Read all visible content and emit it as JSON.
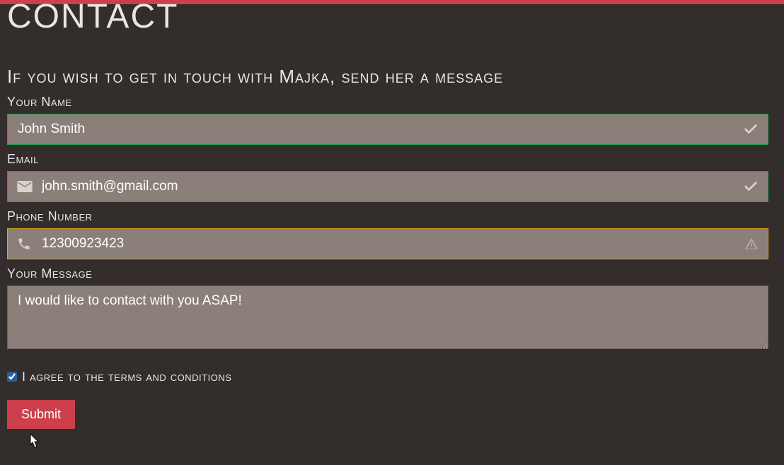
{
  "page": {
    "title": "CONTACT",
    "subtitle": "If you wish to get in touch with Majka, send her a message"
  },
  "form": {
    "name": {
      "label": "Your Name",
      "value": "John Smith"
    },
    "email": {
      "label": "Email",
      "value": "john.smith@gmail.com"
    },
    "phone": {
      "label": "Phone Number",
      "value": "12300923423"
    },
    "message": {
      "label": "Your Message",
      "value": "I would like to contact with you ASAP!"
    },
    "terms": {
      "label": "I agree to the terms and conditions",
      "checked": true
    },
    "submit_label": "Submit"
  }
}
